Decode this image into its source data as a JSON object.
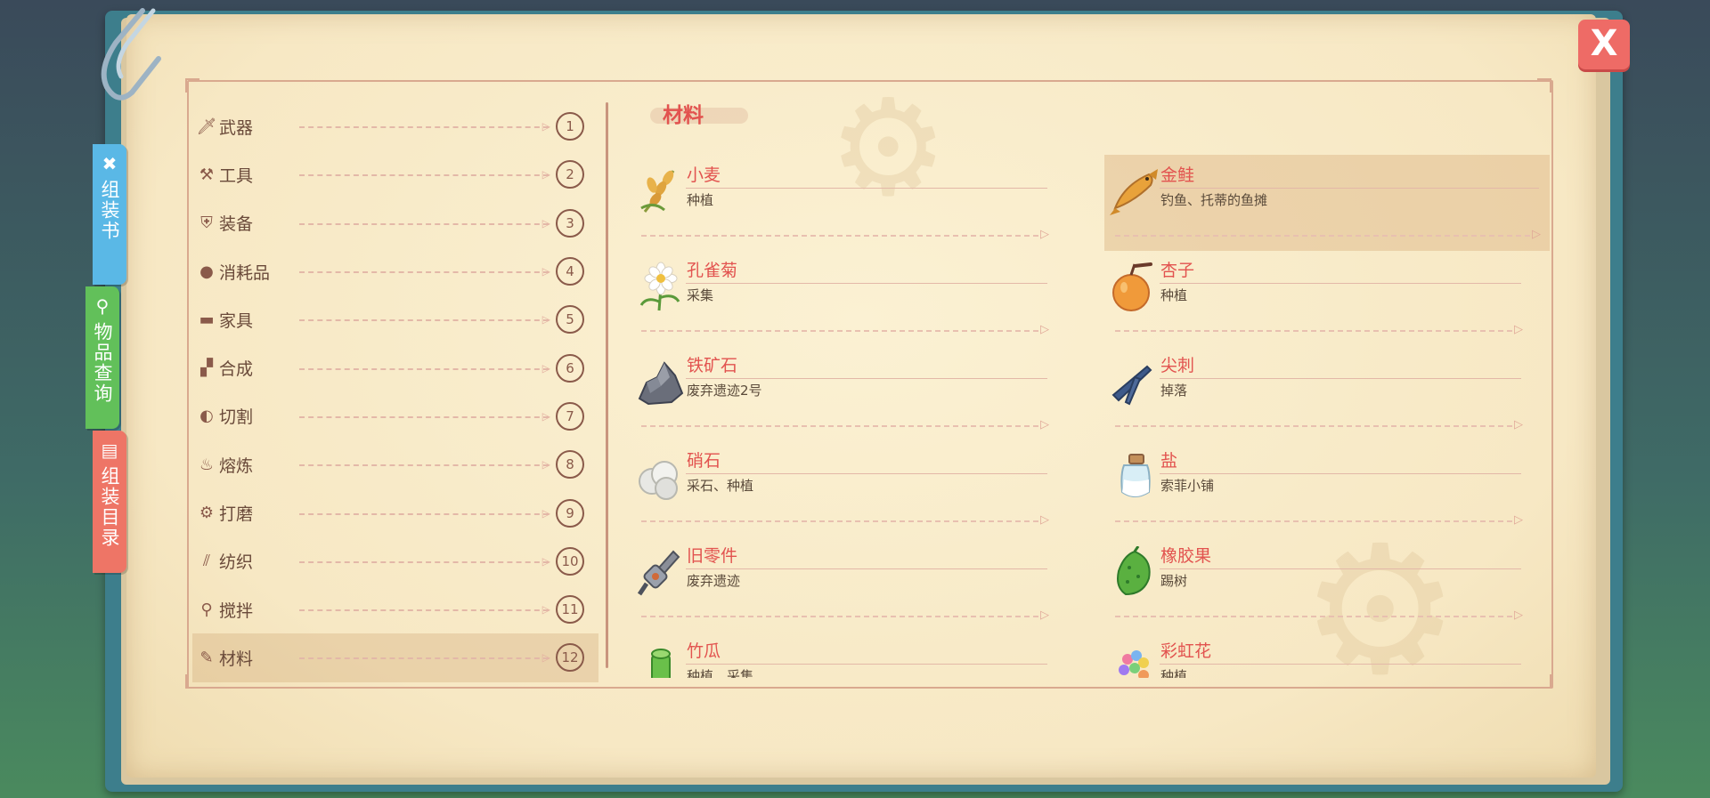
{
  "window": {
    "close_label": "X"
  },
  "side_tabs": [
    {
      "label": "组装书",
      "icon": "tools-icon"
    },
    {
      "label": "物品查询",
      "icon": "magnifier-icon"
    },
    {
      "label": "组装目录",
      "icon": "book-icon"
    }
  ],
  "categories": [
    {
      "label": "武器",
      "num": "1",
      "icon": "sword-icon"
    },
    {
      "label": "工具",
      "num": "2",
      "icon": "hammer-icon"
    },
    {
      "label": "装备",
      "num": "3",
      "icon": "armor-icon"
    },
    {
      "label": "消耗品",
      "num": "4",
      "icon": "food-icon"
    },
    {
      "label": "家具",
      "num": "5",
      "icon": "furniture-icon"
    },
    {
      "label": "合成",
      "num": "6",
      "icon": "blocks-icon"
    },
    {
      "label": "切割",
      "num": "7",
      "icon": "saw-icon"
    },
    {
      "label": "熔炼",
      "num": "8",
      "icon": "flame-icon"
    },
    {
      "label": "打磨",
      "num": "9",
      "icon": "grind-icon"
    },
    {
      "label": "纺织",
      "num": "10",
      "icon": "thread-icon"
    },
    {
      "label": "搅拌",
      "num": "11",
      "icon": "mixer-icon"
    },
    {
      "label": "材料",
      "num": "12",
      "icon": "material-icon",
      "selected": true
    }
  ],
  "section": {
    "title": "材料"
  },
  "items": [
    {
      "name": "小麦",
      "source": "种植",
      "icon": "wheat-icon"
    },
    {
      "name": "金鲑",
      "source": "钓鱼、托蒂的鱼摊",
      "icon": "golden-salmon-icon",
      "selected": true
    },
    {
      "name": "孔雀菊",
      "source": "采集",
      "icon": "daisy-icon"
    },
    {
      "name": "杏子",
      "source": "种植",
      "icon": "apricot-icon"
    },
    {
      "name": "铁矿石",
      "source": "废弃遗迹2号",
      "icon": "iron-ore-icon"
    },
    {
      "name": "尖刺",
      "source": "掉落",
      "icon": "spike-icon"
    },
    {
      "name": "硝石",
      "source": "采石、种植",
      "icon": "saltpeter-icon"
    },
    {
      "name": "盐",
      "source": "索菲小铺",
      "icon": "salt-jar-icon"
    },
    {
      "name": "旧零件",
      "source": "废弃遗迹",
      "icon": "old-part-icon"
    },
    {
      "name": "橡胶果",
      "source": "踢树",
      "icon": "rubber-fruit-icon"
    },
    {
      "name": "竹瓜",
      "source": "种植、采集",
      "icon": "bamboo-melon-icon"
    },
    {
      "name": "彩虹花",
      "source": "种植",
      "icon": "rainbow-flower-icon"
    }
  ],
  "colors": {
    "accent_red": "#e2534f",
    "ink_brown": "#8a5a4a",
    "paper": "#f7e8c4"
  }
}
